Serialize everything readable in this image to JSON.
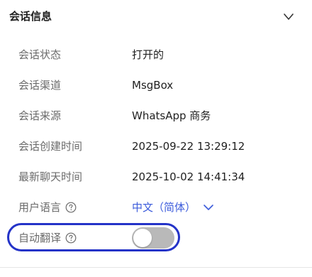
{
  "panel": {
    "title": "会话信息",
    "collapse_icon": "chevron-down-icon"
  },
  "rows": [
    {
      "label": "会话状态",
      "value": "打开的"
    },
    {
      "label": "会话渠道",
      "value": "MsgBox"
    },
    {
      "label": "会话来源",
      "value": "WhatsApp 商务"
    },
    {
      "label": "会话创建时间",
      "value": "2025-09-22 13:29:12"
    },
    {
      "label": "最新聊天时间",
      "value": "2025-10-02 14:41:34"
    }
  ],
  "language": {
    "label": "用户语言",
    "value": "中文（简体）",
    "help_icon": "question-circle-icon",
    "dropdown_icon": "chevron-down-icon",
    "accent_color": "#3b5bdb"
  },
  "auto_translate": {
    "label": "自动翻译",
    "help_icon": "question-circle-icon",
    "enabled": false,
    "highlight_color": "#2433c8"
  }
}
